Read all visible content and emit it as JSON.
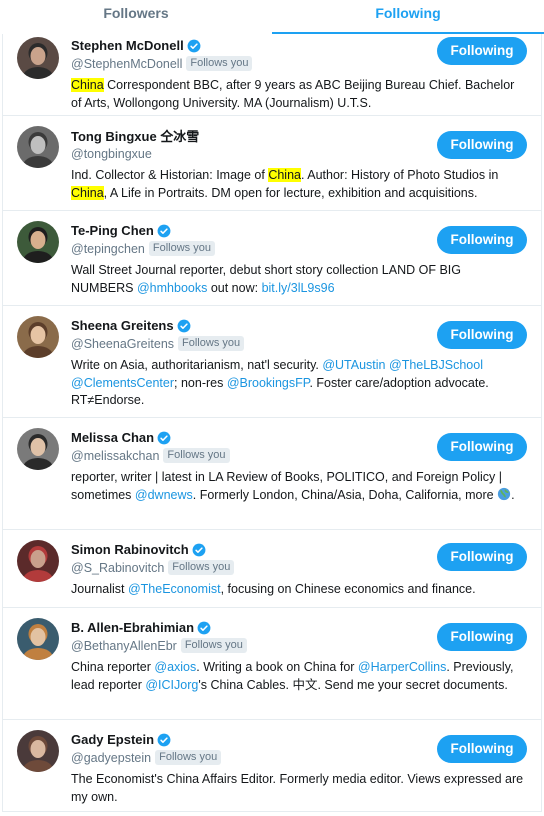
{
  "tabs": {
    "followers": "Followers",
    "following": "Following"
  },
  "colors": {
    "accent": "#1da1f2",
    "link": "#1b95e0",
    "highlight": "#ffff00",
    "muted": "#657786"
  },
  "follows_you_label": "Follows you",
  "users": [
    {
      "name": "Stephen McDonell",
      "verified": true,
      "handle": "@StephenMcDonell",
      "follows_you": true,
      "bio": [
        {
          "t": "China",
          "k": "hl"
        },
        {
          "t": " Correspondent BBC, after 9 years as ABC Beijing Bureau Chief. Bachelor of Arts, Wollongong University. MA (Journalism) U.T.S.",
          "k": "text"
        }
      ],
      "button": "Following"
    },
    {
      "name": "Tong Bingxue 仝冰雪",
      "verified": false,
      "handle": "@tongbingxue",
      "follows_you": false,
      "bio": [
        {
          "t": "Ind. Collector & Historian: Image of ",
          "k": "text"
        },
        {
          "t": "China",
          "k": "hl"
        },
        {
          "t": ". Author: History of Photo Studios in ",
          "k": "text"
        },
        {
          "t": "China",
          "k": "hl"
        },
        {
          "t": ", A Life in Portraits. DM open for lecture, exhibition and acquisitions.",
          "k": "text"
        }
      ],
      "button": "Following"
    },
    {
      "name": "Te-Ping Chen",
      "verified": true,
      "handle": "@tepingchen",
      "follows_you": true,
      "bio": [
        {
          "t": "Wall Street Journal reporter, debut short story collection LAND OF BIG NUMBERS ",
          "k": "text"
        },
        {
          "t": "@hmhbooks",
          "k": "link"
        },
        {
          "t": " out now: ",
          "k": "text"
        },
        {
          "t": "bit.ly/3lL9s96",
          "k": "link"
        }
      ],
      "button": "Following"
    },
    {
      "name": "Sheena Greitens",
      "verified": true,
      "handle": "@SheenaGreitens",
      "follows_you": true,
      "bio": [
        {
          "t": "Write on Asia, authoritarianism, nat'l security. ",
          "k": "text"
        },
        {
          "t": "@UTAustin",
          "k": "link"
        },
        {
          "t": " ",
          "k": "text"
        },
        {
          "t": "@TheLBJSchool",
          "k": "link"
        },
        {
          "t": " ",
          "k": "text"
        },
        {
          "t": "@ClementsCenter",
          "k": "link"
        },
        {
          "t": "; non-res ",
          "k": "text"
        },
        {
          "t": "@BrookingsFP",
          "k": "link"
        },
        {
          "t": ". Foster care/adoption advocate. RT≠Endorse.",
          "k": "text"
        }
      ],
      "button": "Following"
    },
    {
      "name": "Melissa Chan",
      "verified": true,
      "handle": "@melissakchan",
      "follows_you": true,
      "bio": [
        {
          "t": "reporter, writer | latest in LA Review of Books, POLITICO, and Foreign Policy | sometimes ",
          "k": "text"
        },
        {
          "t": "@dwnews",
          "k": "link"
        },
        {
          "t": ". Formerly London, China/Asia, Doha, California, more ",
          "k": "text"
        },
        {
          "t": "globe",
          "k": "globe"
        },
        {
          "t": ".",
          "k": "text"
        }
      ],
      "button": "Following"
    },
    {
      "name": "Simon Rabinovitch",
      "verified": true,
      "handle": "@S_Rabinovitch",
      "follows_you": true,
      "bio": [
        {
          "t": "Journalist ",
          "k": "text"
        },
        {
          "t": "@TheEconomist",
          "k": "link"
        },
        {
          "t": ", focusing on Chinese economics and finance.",
          "k": "text"
        }
      ],
      "button": "Following"
    },
    {
      "name": "B. Allen-Ebrahimian",
      "verified": true,
      "handle": "@BethanyAllenEbr",
      "follows_you": true,
      "bio": [
        {
          "t": "China reporter ",
          "k": "text"
        },
        {
          "t": "@axios",
          "k": "link"
        },
        {
          "t": ". Writing a book on China for ",
          "k": "text"
        },
        {
          "t": "@HarperCollins",
          "k": "link"
        },
        {
          "t": ". Previously, lead reporter ",
          "k": "text"
        },
        {
          "t": "@ICIJorg",
          "k": "link"
        },
        {
          "t": "'s China Cables. 中文. Send me your secret documents.",
          "k": "text"
        }
      ],
      "button": "Following"
    },
    {
      "name": "Gady Epstein",
      "verified": true,
      "handle": "@gadyepstein",
      "follows_you": true,
      "bio": [
        {
          "t": "The Economist's China Affairs Editor. Formerly media editor. Views expressed are my own.",
          "k": "text"
        }
      ],
      "button": "Following"
    }
  ]
}
